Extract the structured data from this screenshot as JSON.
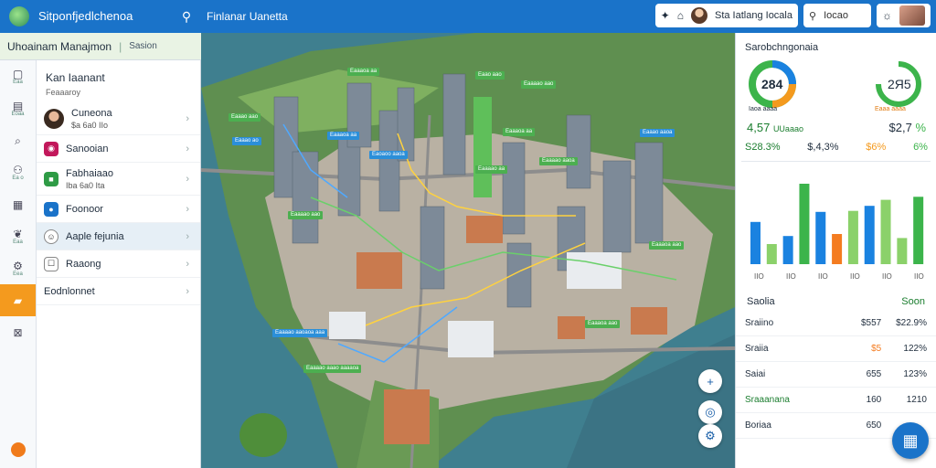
{
  "topbar": {
    "app_title": "Sitponfjedlchenoa ⠀",
    "page_title": "Finlanar Uanetta",
    "user_label": "Sta  Iatlang Iocala",
    "search_label": "Iocao"
  },
  "panel": {
    "title": "Uhoainam Manajmon",
    "subtitle": "Sasion"
  },
  "rail": [
    {
      "icon": "home-icon",
      "glyph": "▢",
      "label": "Eaa"
    },
    {
      "icon": "document-icon",
      "glyph": "▤",
      "label": "Eoaa"
    },
    {
      "icon": "search-icon",
      "glyph": "⌕",
      "label": ""
    },
    {
      "icon": "users-icon",
      "glyph": "⚇",
      "label": "Ea o"
    },
    {
      "icon": "grid-icon",
      "glyph": "▦",
      "label": ""
    },
    {
      "icon": "leaf-icon",
      "glyph": "❦",
      "label": "Eaa"
    },
    {
      "icon": "settings-icon",
      "glyph": "⚙",
      "label": "Eea"
    },
    {
      "icon": "folder-icon",
      "glyph": "▰",
      "label": ""
    },
    {
      "icon": "chart-icon",
      "glyph": "⊠",
      "label": ""
    }
  ],
  "list": {
    "title": "Kan Iaanant",
    "subtitle": "Feaaaroy",
    "items": [
      {
        "title": "Cuneona",
        "detail": "$a 6a0 IIo"
      },
      {
        "title": "Sanooian",
        "detail": ""
      },
      {
        "title": "Fabhaiaao",
        "detail": "Iba 6a0 Ita"
      },
      {
        "title": "Foonoor",
        "detail": ""
      },
      {
        "title": "Aaple fejunia",
        "detail": ""
      },
      {
        "title": "Raaong",
        "detail": ""
      },
      {
        "title": "Eodnlonnet",
        "detail": ""
      }
    ]
  },
  "map": {
    "tags": [
      {
        "label": "Eaaaoa aa",
        "kind": "g"
      },
      {
        "label": "Eaao aao",
        "kind": "g"
      },
      {
        "label": "Eaaaao aao",
        "kind": "g"
      },
      {
        "label": "Eaaao aao",
        "kind": "g"
      },
      {
        "label": "Eaaao ao",
        "kind": "b"
      },
      {
        "label": "Eaaaoa aa",
        "kind": "g"
      },
      {
        "label": "Eaaaoa aa",
        "kind": "b"
      },
      {
        "label": "Eaoaoo aaoa",
        "kind": "b"
      },
      {
        "label": "Eaaaao aa",
        "kind": "g"
      },
      {
        "label": "Eaaaao aaoa",
        "kind": "g"
      },
      {
        "label": "Eaaaao aao",
        "kind": "g"
      },
      {
        "label": "Eaaaoa aao",
        "kind": "g"
      },
      {
        "label": "Eaaaoa aao",
        "kind": "g"
      },
      {
        "label": "Eaaao aaoa",
        "kind": "b"
      },
      {
        "label": "Eaaaao aaoaoa aaa",
        "kind": "b"
      },
      {
        "label": "Eaaaao aaao aaaaoa",
        "kind": "g"
      }
    ]
  },
  "right": {
    "title": "Sarobchngonaia",
    "donut1_value": "284",
    "donut1_caption": "Iaoa aaaa",
    "donut2_value": "2Я5",
    "donut2_caption": "Eaaa aaaa",
    "kpi_a": "4,57",
    "kpi_a_label": "UUaaao",
    "kpi_b": "$2,7",
    "kpi_b_icon": "%",
    "kpi_c": "S28.3%",
    "kpi_d": "$,4,3%",
    "kpi_e": "$6%",
    "kpi_f": "6%",
    "bars_axis": [
      "IIO",
      "IIO",
      "IIO",
      "IIO",
      "IIO",
      "IIO"
    ],
    "table_title": "Saolia",
    "table_action": "Soon",
    "rows": [
      {
        "name": "Sraiino",
        "v1": "$557",
        "v2": "$22.9%"
      },
      {
        "name": "Sraiia",
        "v1": "$5",
        "v2": "122%"
      },
      {
        "name": "Saiai",
        "v1": "655",
        "v2": "123%"
      },
      {
        "name": "Sraaanana",
        "v1": "160",
        "v2": "1210"
      },
      {
        "name": "Boriaa",
        "v1": "650",
        "v2": ""
      }
    ]
  },
  "chart_data": {
    "type": "bar",
    "categories": [
      "IIO",
      "IIO",
      "IIO",
      "IIO",
      "IIO",
      "IIO"
    ],
    "series": [
      {
        "values": [
          42,
          18,
          28,
          80,
          52,
          30,
          53,
          58,
          64
        ]
      },
      {
        "values": [
          20,
          26,
          70
        ]
      }
    ],
    "bars": [
      {
        "v": 42,
        "c": "#1a82e0"
      },
      {
        "v": 20,
        "c": "#8bd16a"
      },
      {
        "v": 28,
        "c": "#1a82e0"
      },
      {
        "v": 80,
        "c": "#3cb44b"
      },
      {
        "v": 52,
        "c": "#1a82e0"
      },
      {
        "v": 30,
        "c": "#f47c20"
      },
      {
        "v": 53,
        "c": "#8bd16a"
      },
      {
        "v": 58,
        "c": "#1a82e0"
      },
      {
        "v": 64,
        "c": "#8bd16a"
      },
      {
        "v": 26,
        "c": "#8bd16a"
      },
      {
        "v": 67,
        "c": "#3cb44b"
      }
    ],
    "ylim": [
      0,
      100
    ]
  },
  "colors": {
    "topbar": "#1a73c9",
    "accent_orange": "#f49a1e",
    "green": "#3cb44b",
    "blue": "#1a82e0"
  }
}
